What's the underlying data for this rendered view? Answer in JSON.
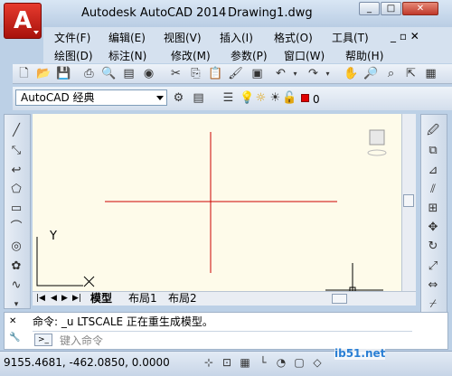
{
  "window": {
    "app_title": "Autodesk AutoCAD 2014",
    "doc_title": "Drawing1.dwg",
    "minimize": "_",
    "maximize": "□",
    "close": "✕"
  },
  "menu": {
    "row1": [
      "文件(F)",
      "编辑(E)",
      "视图(V)",
      "插入(I)",
      "格式(O)",
      "工具(T)"
    ],
    "row2": [
      "绘图(D)",
      "标注(N)",
      "修改(M)",
      "参数(P)",
      "窗口(W)",
      "帮助(H)"
    ],
    "doc_controls": "_ ▫ ✕"
  },
  "workspace": {
    "selected": "AutoCAD 经典"
  },
  "layer": {
    "name": "0",
    "color": "#e00000"
  },
  "canvas": {
    "crosshair_color": "#cc0000",
    "background": "#fefbea",
    "ucs_y": "Y",
    "ucs_x": "X"
  },
  "layout_tabs": [
    "模型",
    "布局1",
    "布局2"
  ],
  "command": {
    "history": "命令: _u LTSCALE 正在重生成模型。",
    "placeholder": "键入命令"
  },
  "status": {
    "coords": "9155.4681, -462.0850, 0.0000"
  },
  "watermark": "ib51.net"
}
